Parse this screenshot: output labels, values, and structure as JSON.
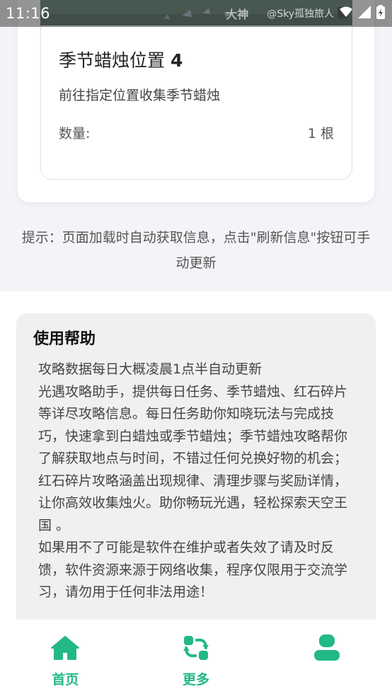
{
  "status_bar": {
    "time": "11:16",
    "watermark_brand": "大神",
    "watermark_user": "@Sky孤独旅人"
  },
  "location_card": {
    "title": "季节蜡烛位置",
    "index": "4",
    "description": "前往指定位置收集季节蜡烛",
    "quantity_label": "数量:",
    "quantity_value": "1 根"
  },
  "hint": "提示：页面加载时自动获取信息，点击\"刷新信息\"按钮可手动更新",
  "help": {
    "title": "使用帮助",
    "line1": "攻略数据每日大概凌晨1点半自动更新",
    "body": "光遇攻略助手，提供每日任务、季节蜡烛、红石碎片等详尽攻略信息。每日任务助你知晓玩法与完成技巧，快速拿到白蜡烛或季节蜡烛；季节蜡烛攻略帮你了解获取地点与时间，不错过任何兑换好物的机会；红石碎片攻略涵盖出现规律、清理步骤与奖励详情，让你高效收集烛火。助你畅玩光遇，轻松探索天空王国 。",
    "notice": "如果用不了可能是软件在维护或者失效了请及时反馈，软件资源来源于网络收集，程序仅限用于交流学习，请勿用于任何非法用途！"
  },
  "nav": {
    "home_label": "首页",
    "more_label": "更多",
    "profile_label": ""
  },
  "colors": {
    "accent": "#22b888",
    "background": "#f3f4f8",
    "help_bg": "#f0f0ee"
  },
  "icons": [
    "home-icon",
    "refresh-icon",
    "user-icon",
    "wifi-icon",
    "signal-icon",
    "battery-icon"
  ]
}
